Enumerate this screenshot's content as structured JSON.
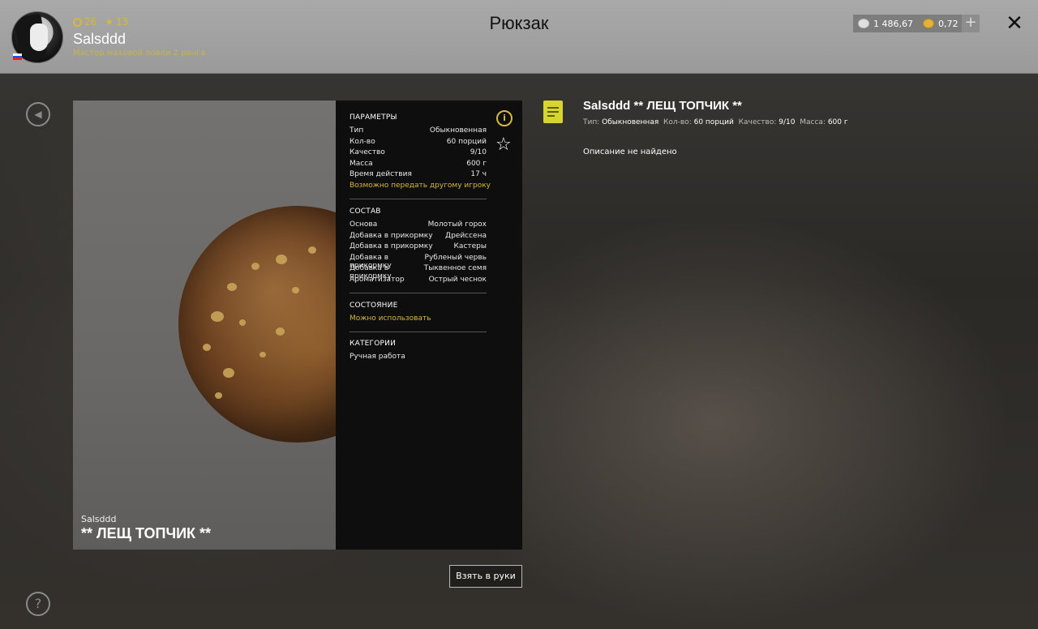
{
  "header": {
    "title": "Рюкзак",
    "username": "Salsddd",
    "rank": "Мастер маховой ловли 2 ранга",
    "level": "26",
    "stars": "13",
    "silver": "1 486,67",
    "gold": "0,72",
    "plus_label": "+",
    "close_label": "✕"
  },
  "item": {
    "owner": "Salsddd",
    "name": "** ЛЕЩ ТОПЧИК **",
    "full_title": "Salsddd ** ЛЕЩ ТОПЧИК **"
  },
  "params": {
    "title": "ПАРАМЕТРЫ",
    "rows": [
      {
        "label": "Тип",
        "value": "Обыкновенная"
      },
      {
        "label": "Кол-во",
        "value": "60 порций"
      },
      {
        "label": "Качество",
        "value": "9/10"
      },
      {
        "label": "Масса",
        "value": "600 г"
      },
      {
        "label": "Время действия",
        "value": "17 ч"
      }
    ],
    "transfer_note": "Возможно передать другому игроку"
  },
  "composition": {
    "title": "СОСТАВ",
    "rows": [
      {
        "label": "Основа",
        "value": "Молотый горох"
      },
      {
        "label": "Добавка в прикормку",
        "value": "Дрейссена"
      },
      {
        "label": "Добавка в прикормку",
        "value": "Кастеры"
      },
      {
        "label": "Добавка в прикормку",
        "value": "Рубленый червь"
      },
      {
        "label": "Добавка в прикормку",
        "value": "Тыквенное семя"
      },
      {
        "label": "Ароматизатор",
        "value": "Острый чеснок"
      }
    ]
  },
  "state": {
    "title": "СОСТОЯНИЕ",
    "value": "Можно использовать"
  },
  "categories": {
    "title": "КАТЕГОРИИ",
    "value": "Ручная работа"
  },
  "description": {
    "meta": {
      "type_label": "Тип:",
      "type_value": "Обыкновенная",
      "qty_label": "Кол-во:",
      "qty_value": "60 порций",
      "quality_label": "Качество:",
      "quality_value": "9/10",
      "mass_label": "Масса:",
      "mass_value": "600 г"
    },
    "text": "Описание не найдено"
  },
  "actions": {
    "take_label": "Взять в руки"
  },
  "colors": {
    "accent": "#d6b93a",
    "header_bg": "#a9a9a9",
    "panel_bg": "#0e0e0e"
  }
}
